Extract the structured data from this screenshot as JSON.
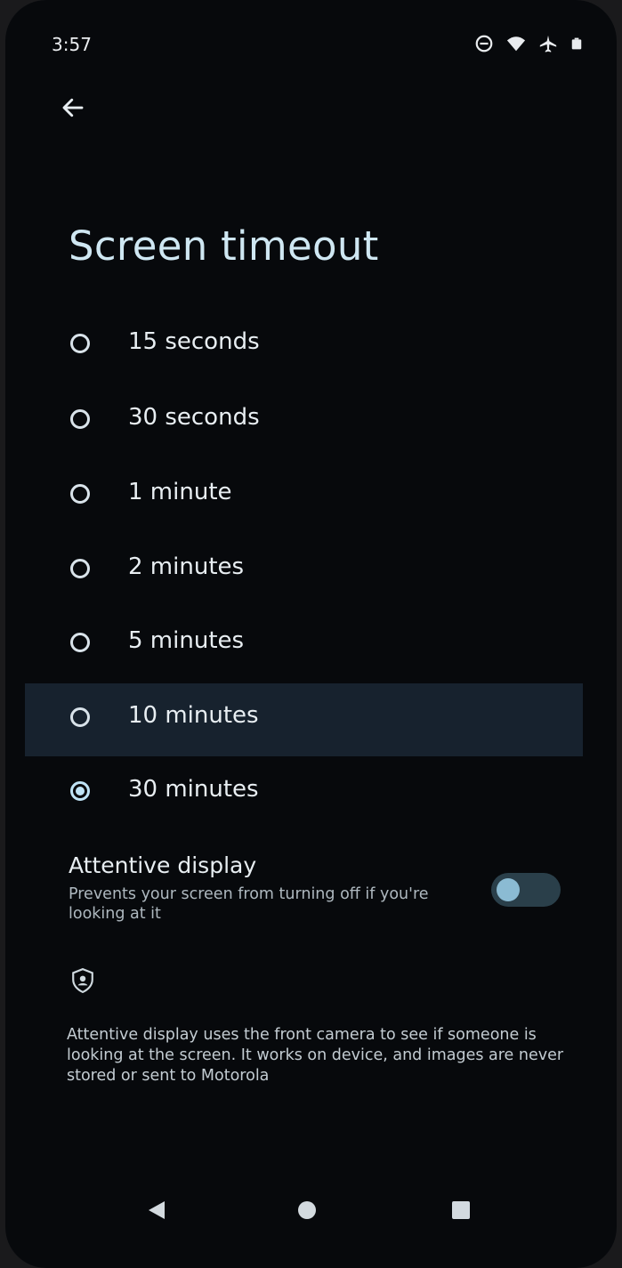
{
  "status_bar": {
    "time": "3:57",
    "icons": [
      "do-not-disturb-icon",
      "wifi-icon",
      "airplane-icon",
      "battery-icon"
    ]
  },
  "header": {
    "back_icon": "arrow-left-icon",
    "title": "Screen timeout"
  },
  "timeout_options": [
    {
      "label": "15 seconds",
      "selected": false
    },
    {
      "label": "30 seconds",
      "selected": false
    },
    {
      "label": "1 minute",
      "selected": false
    },
    {
      "label": "2 minutes",
      "selected": false
    },
    {
      "label": "5 minutes",
      "selected": false
    },
    {
      "label": "10 minutes",
      "selected": false
    },
    {
      "label": "30 minutes",
      "selected": true
    }
  ],
  "attentive_display": {
    "title": "Attentive display",
    "description": "Prevents your screen from turning off if you're looking at it",
    "enabled": false
  },
  "privacy_info": {
    "icon": "shield-icon",
    "text": "Attentive display uses the front camera to see if someone is looking at the screen. It works on device, and images are never stored or sent to Motorola"
  },
  "nav_bar": {
    "back_icon": "triangle-back-icon",
    "home_icon": "circle-home-icon",
    "recents_icon": "square-recents-icon"
  },
  "colors": {
    "background": "#07090c",
    "title": "#cfe7f2",
    "accent": "#bfe3f5",
    "toggle_track": "#2a3f4a"
  }
}
